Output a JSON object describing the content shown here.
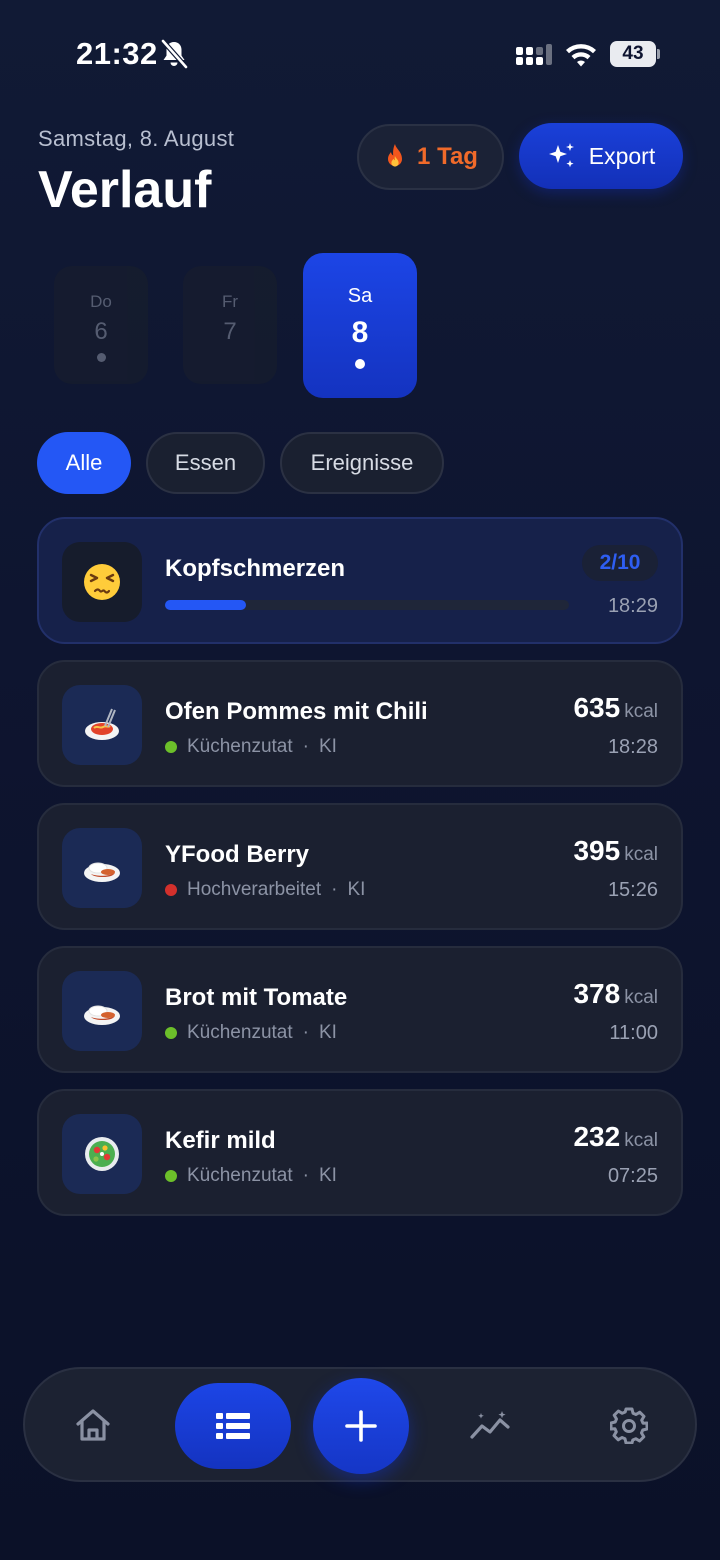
{
  "status_bar": {
    "time": "21:32",
    "battery": "43"
  },
  "header": {
    "date": "Samstag, 8. August",
    "title": "Verlauf",
    "streak_label": "1 Tag",
    "export_label": "Export"
  },
  "days": [
    {
      "name": "Do",
      "num": "6",
      "has_entries": true
    },
    {
      "name": "Fr",
      "num": "7",
      "has_entries": false
    },
    {
      "name": "Sa",
      "num": "8",
      "has_entries": true,
      "selected": true
    }
  ],
  "filters": [
    {
      "label": "Alle",
      "active": true
    },
    {
      "label": "Essen",
      "active": false
    },
    {
      "label": "Ereignisse",
      "active": false
    }
  ],
  "symptom": {
    "title": "Kopfschmerzen",
    "severity": "2/10",
    "severity_fraction": 0.2,
    "time": "18:29"
  },
  "meals": [
    {
      "title": "Ofen Pommes mit Chili",
      "category": "Küchenzutat",
      "source": "KI",
      "kcal": "635",
      "unit": "kcal",
      "time": "18:28",
      "status_color": "#6cbf2a",
      "icon": "spaghetti-icon"
    },
    {
      "title": "YFood Berry",
      "category": "Hochverarbeitet",
      "source": "KI",
      "kcal": "395",
      "unit": "kcal",
      "time": "15:26",
      "status_color": "#d3302c",
      "icon": "curry-rice-icon"
    },
    {
      "title": "Brot mit Tomate",
      "category": "Küchenzutat",
      "source": "KI",
      "kcal": "378",
      "unit": "kcal",
      "time": "11:00",
      "status_color": "#6cbf2a",
      "icon": "curry-rice-icon"
    },
    {
      "title": "Kefir mild",
      "category": "Küchenzutat",
      "source": "KI",
      "kcal": "232",
      "unit": "kcal",
      "time": "07:25",
      "status_color": "#6cbf2a",
      "icon": "salad-icon"
    }
  ],
  "nav": [
    "home-icon",
    "list-icon",
    "plus-icon",
    "trend-icon",
    "gear-icon"
  ],
  "colors": {
    "accent": "#2457f5",
    "streak": "#f06a2a",
    "background": "#0e1530"
  }
}
